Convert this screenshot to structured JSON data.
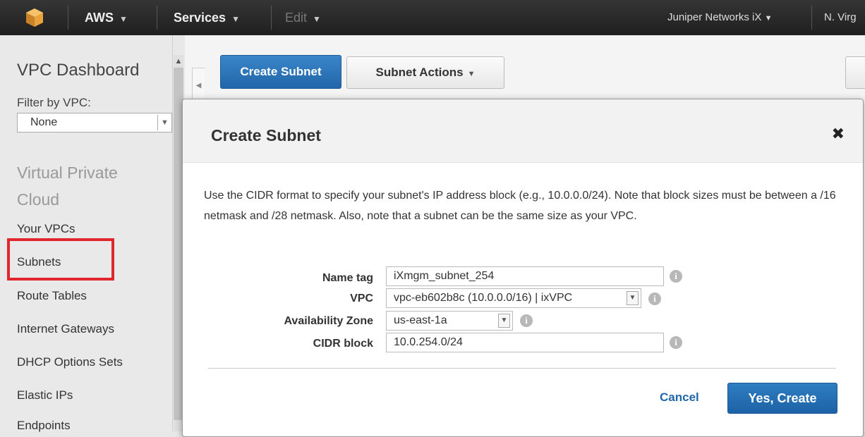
{
  "topbar": {
    "logo_icon": "aws-cube-icon",
    "aws_label": "AWS",
    "services_label": "Services",
    "edit_label": "Edit",
    "account_label": "Juniper Networks iX",
    "region_label": "N. Virg"
  },
  "sidebar": {
    "title": "VPC Dashboard",
    "filter_label": "Filter by VPC:",
    "filter_value": "None",
    "section_title": "Virtual Private Cloud",
    "items": [
      {
        "label": "Your VPCs"
      },
      {
        "label": "Subnets"
      },
      {
        "label": "Route Tables"
      },
      {
        "label": "Internet Gateways"
      },
      {
        "label": "DHCP Options Sets"
      },
      {
        "label": "Elastic IPs"
      },
      {
        "label": "Endpoints"
      }
    ]
  },
  "toolbar": {
    "create_subnet_label": "Create Subnet",
    "subnet_actions_label": "Subnet Actions"
  },
  "modal": {
    "title": "Create Subnet",
    "description": "Use the CIDR format to specify your subnet's IP address block (e.g., 10.0.0.0/24). Note that block sizes must be between a /16 netmask and /28 netmask. Also, note that a subnet can be the same size as your VPC.",
    "fields": {
      "name_tag": {
        "label": "Name tag",
        "value": "iXmgm_subnet_254"
      },
      "vpc": {
        "label": "VPC",
        "value": "vpc-eb602b8c (10.0.0.0/16) | ixVPC"
      },
      "availability_zone": {
        "label": "Availability Zone",
        "value": "us-east-1a"
      },
      "cidr_block": {
        "label": "CIDR block",
        "value": "10.0.254.0/24"
      }
    },
    "cancel_label": "Cancel",
    "confirm_label": "Yes, Create"
  },
  "colors": {
    "primary_button": "#2166a9",
    "highlight_box": "#e0282c",
    "topbar": "#232f3e"
  }
}
